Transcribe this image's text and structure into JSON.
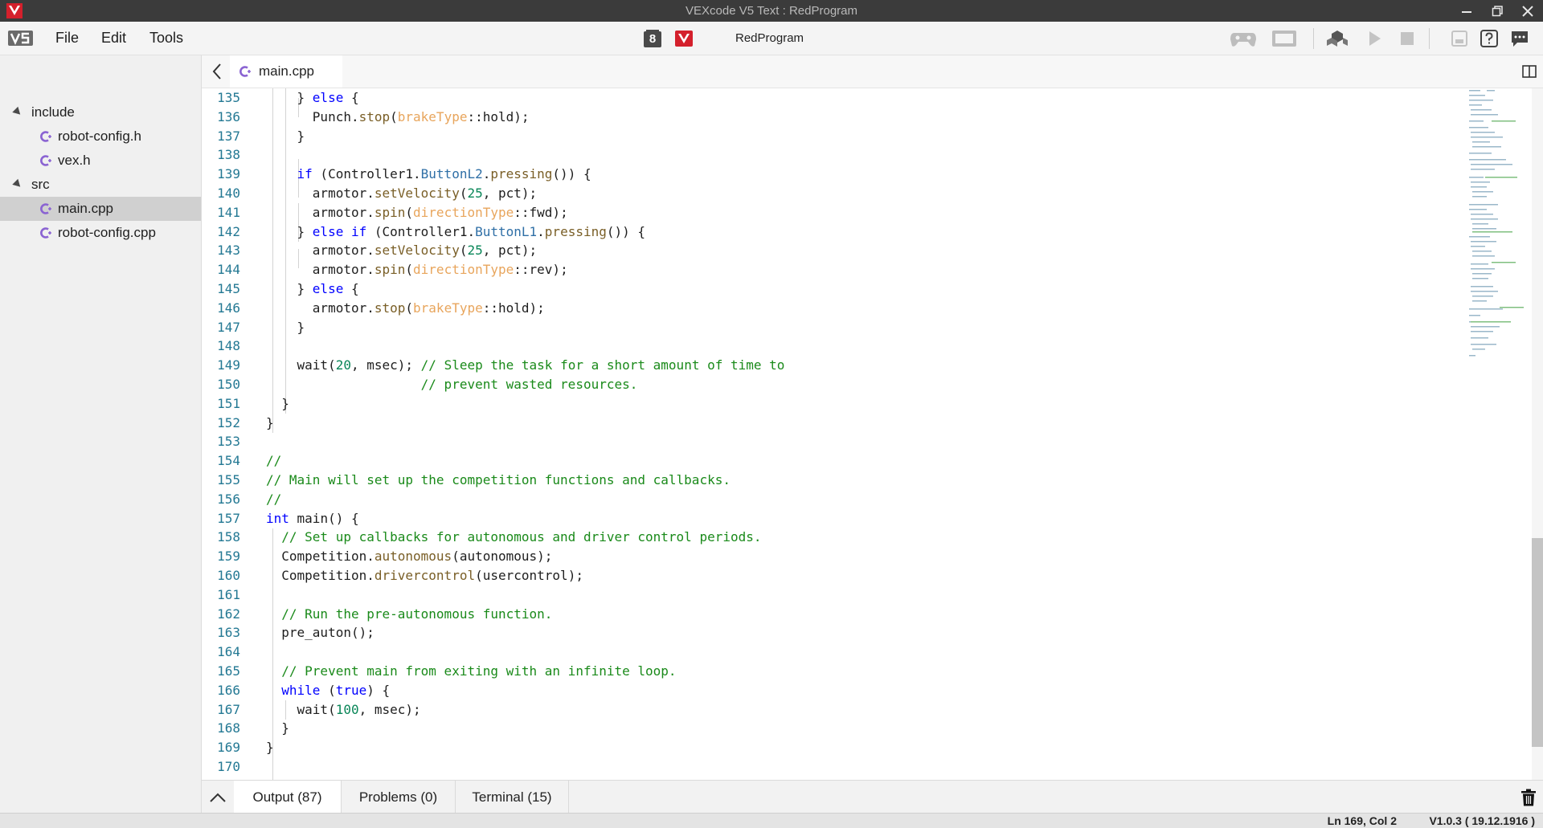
{
  "window": {
    "title": "VEXcode V5 Text : RedProgram"
  },
  "menu": {
    "file": "File",
    "edit": "Edit",
    "tools": "Tools"
  },
  "toolbar": {
    "slot_number": "8",
    "program_name": "RedProgram"
  },
  "sidebar": {
    "items": [
      {
        "label": "include",
        "type": "folder"
      },
      {
        "label": "robot-config.h",
        "type": "file"
      },
      {
        "label": "vex.h",
        "type": "file"
      },
      {
        "label": "src",
        "type": "folder"
      },
      {
        "label": "main.cpp",
        "type": "file",
        "selected": true
      },
      {
        "label": "robot-config.cpp",
        "type": "file"
      }
    ]
  },
  "editor": {
    "active_tab": "main.cpp",
    "lines": [
      {
        "n": "135",
        "text": "    } else {"
      },
      {
        "n": "136",
        "text": "      Punch.stop(brakeType::hold);"
      },
      {
        "n": "137",
        "text": "    }"
      },
      {
        "n": "138",
        "text": ""
      },
      {
        "n": "139",
        "text": "    if (Controller1.ButtonL2.pressing()) {"
      },
      {
        "n": "140",
        "text": "      armotor.setVelocity(25, pct);"
      },
      {
        "n": "141",
        "text": "      armotor.spin(directionType::fwd);"
      },
      {
        "n": "142",
        "text": "    } else if (Controller1.ButtonL1.pressing()) {"
      },
      {
        "n": "143",
        "text": "      armotor.setVelocity(25, pct);"
      },
      {
        "n": "144",
        "text": "      armotor.spin(directionType::rev);"
      },
      {
        "n": "145",
        "text": "    } else {"
      },
      {
        "n": "146",
        "text": "      armotor.stop(brakeType::hold);"
      },
      {
        "n": "147",
        "text": "    }"
      },
      {
        "n": "148",
        "text": ""
      },
      {
        "n": "149",
        "text": "    wait(20, msec); // Sleep the task for a short amount of time to"
      },
      {
        "n": "150",
        "text": "                    // prevent wasted resources."
      },
      {
        "n": "151",
        "text": "  }"
      },
      {
        "n": "152",
        "text": "}"
      },
      {
        "n": "153",
        "text": ""
      },
      {
        "n": "154",
        "text": "//"
      },
      {
        "n": "155",
        "text": "// Main will set up the competition functions and callbacks."
      },
      {
        "n": "156",
        "text": "//"
      },
      {
        "n": "157",
        "text": "int main() {"
      },
      {
        "n": "158",
        "text": "  // Set up callbacks for autonomous and driver control periods."
      },
      {
        "n": "159",
        "text": "  Competition.autonomous(autonomous);"
      },
      {
        "n": "160",
        "text": "  Competition.drivercontrol(usercontrol);"
      },
      {
        "n": "161",
        "text": ""
      },
      {
        "n": "162",
        "text": "  // Run the pre-autonomous function."
      },
      {
        "n": "163",
        "text": "  pre_auton();"
      },
      {
        "n": "164",
        "text": ""
      },
      {
        "n": "165",
        "text": "  // Prevent main from exiting with an infinite loop."
      },
      {
        "n": "166",
        "text": "  while (true) {"
      },
      {
        "n": "167",
        "text": "    wait(100, msec);"
      },
      {
        "n": "168",
        "text": "  }"
      },
      {
        "n": "169",
        "text": "}"
      },
      {
        "n": "170",
        "text": ""
      }
    ]
  },
  "panel": {
    "output_label": "Output (87)",
    "problems_label": "Problems (0)",
    "terminal_label": "Terminal (15)"
  },
  "status": {
    "position": "Ln 169, Col 2",
    "version": "V1.0.3 ( 19.12.1916 )"
  },
  "colors": {
    "titlebar_bg": "#3b3b3b",
    "vex_red": "#d4202c",
    "keyword": "#0000ff",
    "comment": "#1a8a1a",
    "number": "#098658",
    "enum_type": "#e8a55c",
    "line_number": "#237893"
  }
}
